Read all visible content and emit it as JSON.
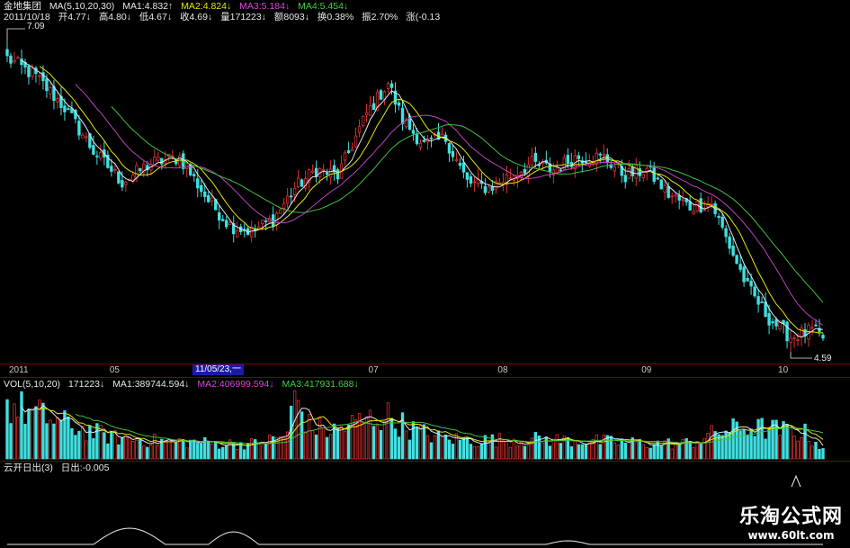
{
  "header": {
    "security": "金地集团",
    "ma_label": "MA(5,10,20,30)",
    "ma1": "MA1:4.832↑",
    "ma2": "MA2:4.824↓",
    "ma3": "MA3:5.184↓",
    "ma4": "MA4:5.454↓",
    "date": "2011/10/18",
    "open": "开4.77↓",
    "high": "高4.80↓",
    "low": "低4.67↓",
    "close": "收4.69↓",
    "vol": "量171223↓",
    "amount": "额8093↓",
    "turnover": "换0.38%",
    "amplitude": "振2.70%",
    "change": "涨(-0.13"
  },
  "axis": {
    "ticks": [
      {
        "label": "2011",
        "idx": 0
      },
      {
        "label": "05",
        "idx": 28
      },
      {
        "label": "07",
        "idx": 100
      },
      {
        "label": "08",
        "idx": 136
      },
      {
        "label": "09",
        "idx": 176
      },
      {
        "label": "10",
        "idx": 214
      }
    ],
    "cursor_date": "11/05/23,一"
  },
  "price_labels": {
    "max": "7.09",
    "min": "4.59"
  },
  "vol_header": {
    "label": "VOL(5,10,20)",
    "value": "171223↓",
    "ma1": "MA1:389744.594↓",
    "ma2": "MA2:406999.594↓",
    "ma3": "MA3:417931.688↓"
  },
  "ind_header": {
    "label": "云开日出(3)",
    "value": "日出:-0.005"
  },
  "watermark": {
    "title": "乐淘公式网",
    "url": "www.60lt.com"
  },
  "colors": {
    "up": "#e03030",
    "down": "#40e0e0",
    "ma1": "#e8e8e8",
    "ma2": "#e8e800",
    "ma3": "#c040c0",
    "ma4": "#40c040",
    "grid": "#7a0000"
  },
  "chart_data": {
    "type": "candlestick",
    "n": 228,
    "ylim": [
      4.5,
      7.2
    ],
    "closes_keypoints": [
      [
        0,
        6.95
      ],
      [
        8,
        6.8
      ],
      [
        16,
        6.55
      ],
      [
        24,
        6.2
      ],
      [
        32,
        5.95
      ],
      [
        40,
        6.1
      ],
      [
        48,
        6.15
      ],
      [
        56,
        5.8
      ],
      [
        62,
        5.6
      ],
      [
        68,
        5.55
      ],
      [
        74,
        5.65
      ],
      [
        80,
        5.9
      ],
      [
        86,
        6.05
      ],
      [
        92,
        6.0
      ],
      [
        100,
        6.5
      ],
      [
        106,
        6.75
      ],
      [
        110,
        6.45
      ],
      [
        116,
        6.25
      ],
      [
        122,
        6.3
      ],
      [
        128,
        5.95
      ],
      [
        134,
        5.9
      ],
      [
        140,
        6.0
      ],
      [
        146,
        6.1
      ],
      [
        152,
        6.05
      ],
      [
        158,
        6.15
      ],
      [
        166,
        6.15
      ],
      [
        172,
        6.0
      ],
      [
        178,
        6.05
      ],
      [
        184,
        5.85
      ],
      [
        190,
        5.75
      ],
      [
        196,
        5.78
      ],
      [
        200,
        5.5
      ],
      [
        206,
        5.1
      ],
      [
        212,
        4.85
      ],
      [
        218,
        4.7
      ],
      [
        224,
        4.75
      ],
      [
        227,
        4.69
      ]
    ],
    "vol_keypoints": [
      [
        0,
        900000
      ],
      [
        10,
        700000
      ],
      [
        20,
        500000
      ],
      [
        30,
        350000
      ],
      [
        40,
        300000
      ],
      [
        50,
        280000
      ],
      [
        60,
        250000
      ],
      [
        70,
        250000
      ],
      [
        78,
        400000
      ],
      [
        80,
        1050000
      ],
      [
        84,
        550000
      ],
      [
        90,
        450000
      ],
      [
        100,
        650000
      ],
      [
        106,
        700000
      ],
      [
        112,
        500000
      ],
      [
        120,
        350000
      ],
      [
        130,
        300000
      ],
      [
        140,
        320000
      ],
      [
        150,
        320000
      ],
      [
        160,
        300000
      ],
      [
        170,
        280000
      ],
      [
        180,
        250000
      ],
      [
        190,
        260000
      ],
      [
        198,
        450000
      ],
      [
        206,
        520000
      ],
      [
        214,
        480000
      ],
      [
        222,
        420000
      ],
      [
        227,
        171223
      ]
    ],
    "vol_ylim": [
      0,
      1100000
    ]
  }
}
